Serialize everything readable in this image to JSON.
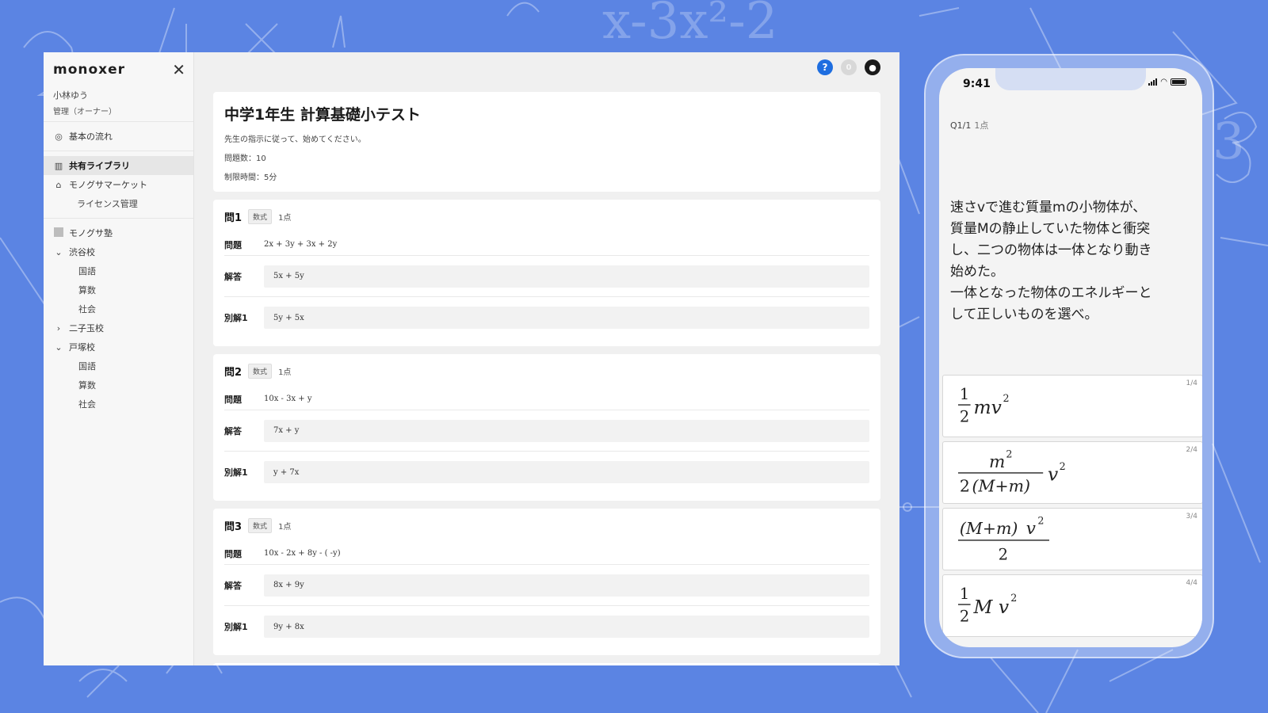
{
  "app": {
    "logo": "monoxer",
    "user_name": "小林ゆう",
    "user_role": "管理（オーナー）",
    "close_glyph": "✕"
  },
  "sidebar": {
    "basic_flow": "基本の流れ",
    "shared_library": "共有ライブラリ",
    "market": "モノグサマーケット",
    "license": "ライセンス管理",
    "school": "モノグサ塾",
    "branches": [
      {
        "name": "渋谷校",
        "expanded": true,
        "subjects": [
          "国語",
          "算数",
          "社会"
        ]
      },
      {
        "name": "二子玉校",
        "expanded": false,
        "subjects": []
      },
      {
        "name": "戸塚校",
        "expanded": true,
        "subjects": [
          "国語",
          "算数",
          "社会"
        ]
      }
    ]
  },
  "topbar": {
    "help": "?",
    "notifications": "0"
  },
  "test": {
    "title": "中学1年生 計算基礎小テスト",
    "instruction": "先生の指示に従って、始めてください。",
    "count": "問題数：10",
    "time_limit": "制限時間：5分"
  },
  "labels": {
    "question": "問題",
    "answer": "解答",
    "alternative": "別解1"
  },
  "questions": [
    {
      "no": "問1",
      "tag": "数式",
      "points": "1点",
      "question": "2x + 3y + 3x + 2y",
      "answer": "5x + 5y",
      "alternative": "5y + 5x"
    },
    {
      "no": "問2",
      "tag": "数式",
      "points": "1点",
      "question": "10x - 3x + y",
      "answer": "7x + y",
      "alternative": "y + 7x"
    },
    {
      "no": "問3",
      "tag": "数式",
      "points": "1点",
      "question": "10x - 2x + 8y - ( -y)",
      "answer": "8x + 9y",
      "alternative": "9y + 8x"
    }
  ],
  "phone": {
    "time": "9:41",
    "question_index": "Q1/1",
    "points": "1点",
    "question_lines": [
      "速さvで進む質量mの小物体が、",
      "質量Mの静止していた物体と衝突",
      "し、二つの物体は一体となり動き",
      "始めた。",
      "一体となった物体のエネルギーと",
      "して正しいものを選べ。"
    ],
    "choices": [
      {
        "no": "1/4",
        "formula": "1/2 mv^2"
      },
      {
        "no": "2/4",
        "formula": "m^2 / 2(M+m) v^2"
      },
      {
        "no": "3/4",
        "formula": "(M+m) v^2 / 2"
      },
      {
        "no": "4/4",
        "formula": "1/2 Mv^2"
      }
    ]
  },
  "colors": {
    "background": "#5b84e3",
    "help_blue": "#1e6ee0"
  }
}
